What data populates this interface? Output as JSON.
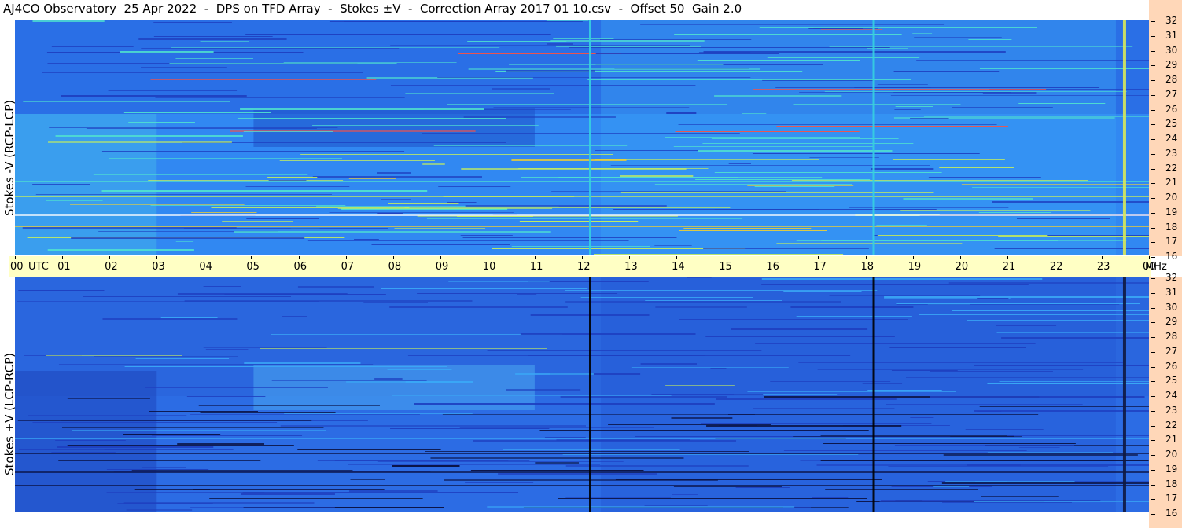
{
  "title": "AJ4CO Observatory  25 Apr 2022  -  DPS on TFD Array  -  Stokes ±V  -  Correction Array 2017 01 10.csv  -  Offset 50  Gain 2.0",
  "chart_data": [
    {
      "type": "heatmap",
      "panel": "top",
      "ylabel": "Stokes -V (RCP-LCP)",
      "y_unit": "MHz",
      "y_range": [
        16,
        32
      ],
      "x_unit": "UTC",
      "x_range": [
        "00",
        "00"
      ],
      "colormap": [
        "#1e3fc0",
        "#2f7df0",
        "#3aa8f6",
        "#4fe0d0",
        "#c8f05a",
        "#f6d22a",
        "#ff5040"
      ],
      "features": [
        {
          "utc": 12.15,
          "kind": "vertical line",
          "color": "#36d0e0"
        },
        {
          "utc": 18.15,
          "kind": "vertical line",
          "color": "#36d0e0"
        },
        {
          "utc": 23.45,
          "kind": "vertical band",
          "color": "#d8e85a"
        }
      ]
    },
    {
      "type": "heatmap",
      "panel": "bottom",
      "ylabel": "Stokes +V (LCP-RCP)",
      "y_unit": "MHz",
      "y_range": [
        16,
        32
      ],
      "x_unit": "UTC",
      "x_range": [
        "00",
        "00"
      ],
      "colormap": [
        "#0a1040",
        "#1e3fc0",
        "#2f7df0",
        "#3aa8f6",
        "#4fe0d0",
        "#c8f05a"
      ],
      "features": [
        {
          "utc": 12.15,
          "kind": "vertical line",
          "color": "#000000"
        },
        {
          "utc": 18.15,
          "kind": "vertical line",
          "color": "#000000"
        },
        {
          "utc": 23.45,
          "kind": "vertical band",
          "color": "#101840"
        }
      ]
    }
  ],
  "xaxis": {
    "utc_label": "UTC",
    "mhz_label": "MHz",
    "ticks": [
      "00",
      "01",
      "02",
      "03",
      "04",
      "05",
      "06",
      "07",
      "08",
      "09",
      "10",
      "11",
      "12",
      "13",
      "14",
      "15",
      "16",
      "17",
      "18",
      "19",
      "20",
      "21",
      "22",
      "23",
      "00"
    ]
  },
  "freq_ticks": [
    "32",
    "31",
    "30",
    "29",
    "28",
    "27",
    "26",
    "25",
    "24",
    "23",
    "22",
    "21",
    "20",
    "19",
    "18",
    "17",
    "16"
  ]
}
